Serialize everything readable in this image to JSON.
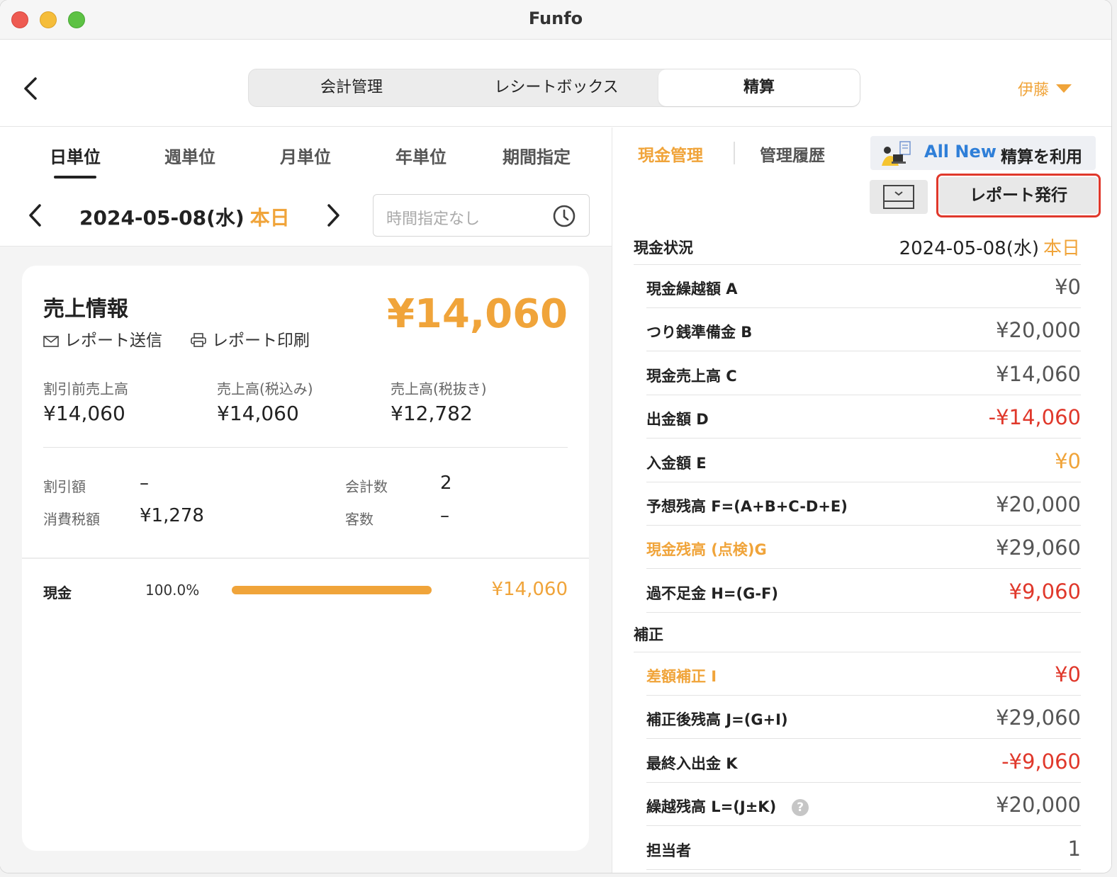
{
  "window": {
    "title": "Funfo"
  },
  "header": {
    "segments": [
      "会計管理",
      "レシートボックス",
      "精算"
    ],
    "user": "伊藤"
  },
  "left": {
    "period_tabs": [
      "日単位",
      "週単位",
      "月単位",
      "年単位",
      "期間指定"
    ],
    "date": "2024-05-08(水)",
    "today": "本日",
    "time_placeholder": "時間指定なし",
    "sales": {
      "title": "売上情報",
      "total": "¥14,060",
      "report_send": "レポート送信",
      "report_print": "レポート印刷",
      "stats": [
        {
          "label": "割引前売上高",
          "value": "¥14,060"
        },
        {
          "label": "売上高(税込み)",
          "value": "¥14,060"
        },
        {
          "label": "売上高(税抜き)",
          "value": "¥12,782"
        }
      ],
      "discount_label": "割引額",
      "discount_value": "–",
      "tax_label": "消費税額",
      "tax_value": "¥1,278",
      "count_label": "会計数",
      "count_value": "2",
      "customers_label": "客数",
      "customers_value": "–",
      "payment": {
        "label": "現金",
        "percent": "100.0%",
        "fraction": 1.0,
        "amount": "¥14,060"
      }
    }
  },
  "right": {
    "tabs": [
      "現金管理",
      "管理履歴"
    ],
    "allnew_highlight": "All New",
    "allnew_text": "精算を利用",
    "report_button": "レポート発行",
    "cash_status": {
      "label": "現金状況",
      "date": "2024-05-08(水)",
      "today": "本日"
    },
    "rows": [
      {
        "label": "現金繰越額 A",
        "value": "¥0"
      },
      {
        "label": "つり銭準備金 B",
        "value": "¥20,000"
      },
      {
        "label": "現金売上高 C",
        "value": "¥14,060"
      },
      {
        "label": "出金額 D",
        "value": "-¥14,060"
      },
      {
        "label": "入金額 E",
        "value": "¥0"
      },
      {
        "label": "予想残高 F=(A+B+C-D+E)",
        "value": "¥20,000"
      },
      {
        "label": "現金残高 (点検)G",
        "value": "¥29,060"
      },
      {
        "label": "過不足金 H=(G-F)",
        "value": "¥9,060"
      }
    ],
    "correction_label": "補正",
    "correction_rows": [
      {
        "label": "差額補正 I",
        "value": "¥0"
      },
      {
        "label": "補正後残高 J=(G+I)",
        "value": "¥29,060"
      },
      {
        "label": "最終入出金 K",
        "value": "-¥9,060"
      },
      {
        "label": "繰越残高 L=(J±K)",
        "value": "¥20,000"
      },
      {
        "label": "担当者",
        "value": "1"
      }
    ],
    "colors": {
      "accent": "#f0a43a",
      "negative": "#e0382b",
      "link": "#2f7fd8"
    }
  }
}
